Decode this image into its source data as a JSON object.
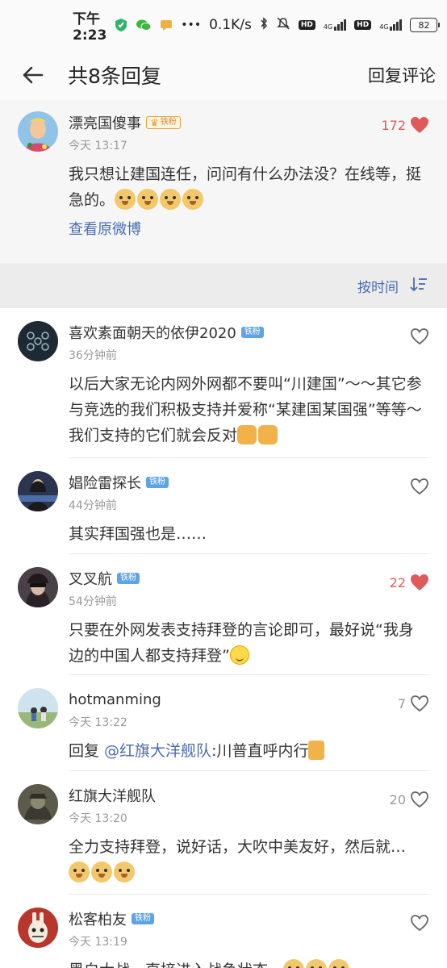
{
  "status_bar": {
    "time": "下午2:23",
    "speed": "0.1K/s",
    "hd1": "HD",
    "hd2": "HD",
    "net1": "4G",
    "net2": "4G",
    "battery": "82"
  },
  "nav": {
    "title": "共8条回复",
    "action": "回复评论"
  },
  "origin": {
    "username": "漂亮国傻事",
    "badge": "铁粉",
    "time": "今天 13:17",
    "likes": "172",
    "text": "我只想让建国连任，问问有什么办法没？在线等，挺急的。",
    "view_original": "查看原微博"
  },
  "sort": {
    "label": "按时间"
  },
  "replies": [
    {
      "username": "喜欢素面朝天的依伊2020",
      "badge": "铁粉",
      "time": "36分钟前",
      "likes": "",
      "text": "以后大家无论内网外网都不要叫“川建国”～～其它参与竞选的我们积极支持并爱称“某建国某国强”等等～我们支持的它们就会反对"
    },
    {
      "username": "娼险雷探长",
      "badge": "铁粉",
      "time": "44分钟前",
      "likes": "",
      "text": "其实拜国强也是……"
    },
    {
      "username": "叉叉航",
      "badge": "铁粉",
      "time": "54分钟前",
      "likes": "22",
      "text": "只要在外网发表支持拜登的言论即可，最好说“我身边的中国人都支持拜登”"
    },
    {
      "username": "hotmanming",
      "badge": "",
      "time": "今天 13:22",
      "likes": "7",
      "text_prefix": "回复 ",
      "mention": "@红旗大洋舰队",
      "text": ":川普直呼内行"
    },
    {
      "username": "红旗大洋舰队",
      "badge": "",
      "time": "今天 13:20",
      "likes": "20",
      "text": "全力支持拜登，说好话，大吹中美友好，然后就…"
    },
    {
      "username": "松客柏友",
      "badge": "铁粉",
      "time": "今天 13:19",
      "likes": "",
      "text": "黑白大战，直接进入战争状态。"
    }
  ],
  "colors": {
    "like_red": "#e05a5a",
    "link_blue": "#4a6cb3",
    "badge_blue": "#5fa3e6"
  }
}
